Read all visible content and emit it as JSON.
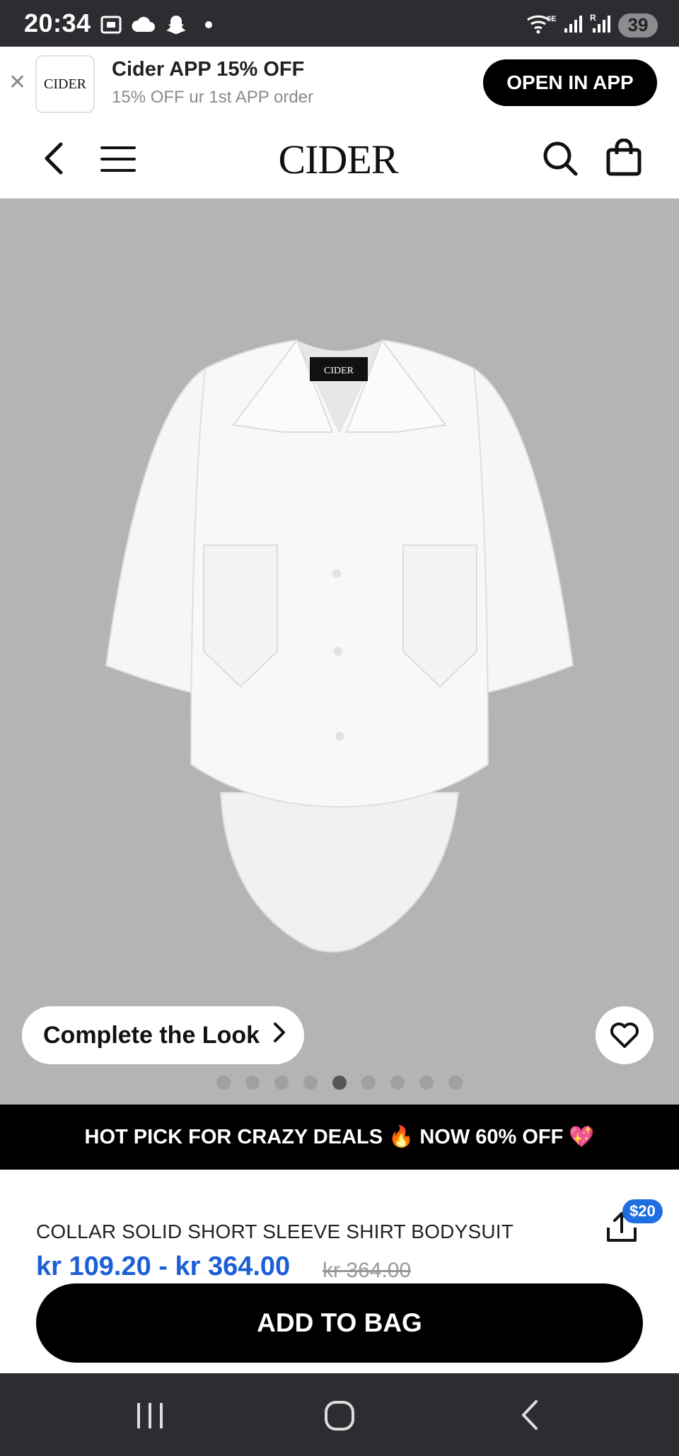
{
  "status_bar": {
    "time": "20:34",
    "battery": "39",
    "icons_left": [
      "screenshot-icon",
      "cloud-icon",
      "snapchat-icon",
      "dot-icon"
    ],
    "icons_right": [
      "wifi-6e-icon",
      "signal-icon",
      "signal-r-icon"
    ]
  },
  "promo": {
    "logo_text": "CIDER",
    "title": "Cider APP 15% OFF",
    "subtitle": "15% OFF ur 1st APP order",
    "button": "OPEN IN APP"
  },
  "header": {
    "brand": "CIDER"
  },
  "gallery": {
    "garment_label": "CIDER",
    "complete_look": "Complete the Look",
    "dots_count": 9,
    "active_dot": 5
  },
  "deal_banner": {
    "text": "HOT PICK FOR CRAZY DEALS 🔥 NOW 60% OFF 💖"
  },
  "product": {
    "title": "COLLAR SOLID SHORT SLEEVE SHIRT BODYSUIT",
    "price": "kr 109.20 - kr 364.00",
    "old_price": "kr 364.00",
    "share_badge": "$20"
  },
  "cta": {
    "add_to_bag": "ADD TO BAG"
  },
  "colors": {
    "accent_price": "#1c5fd6",
    "badge": "#1f6fe0",
    "image_bg": "#b4b4b4"
  }
}
